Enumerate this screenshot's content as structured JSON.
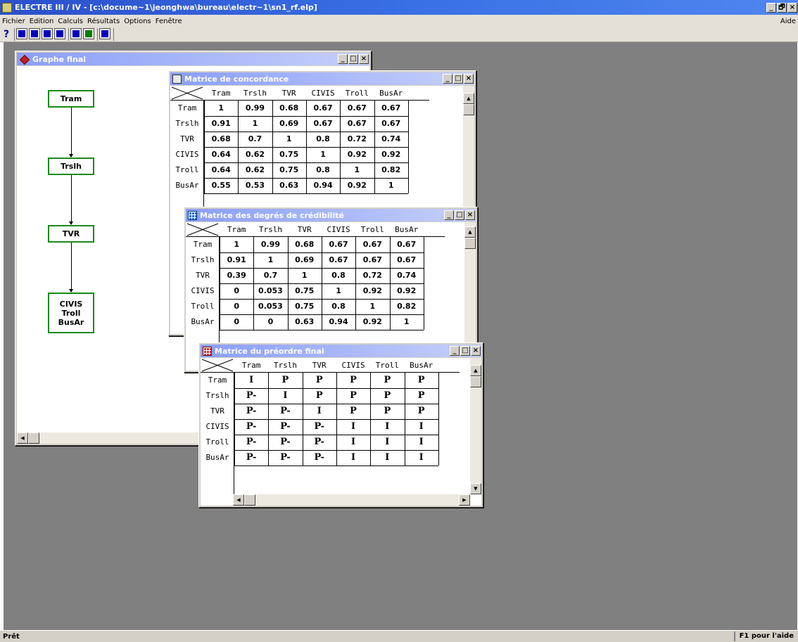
{
  "app": {
    "title": "ELECTRE  III / IV - [c:\\docume~1\\jeonghwa\\bureau\\electr~1\\sn1_rf.elp]",
    "minimize": "_",
    "restore": "🗗",
    "close": "×"
  },
  "menu": {
    "items": [
      "Fichier",
      "Edition",
      "Calculs",
      "Résultats",
      "Options",
      "Fenêtre"
    ],
    "help": "Aide"
  },
  "toolbar": {
    "help_glyph": "?",
    "buttons": [
      {
        "name": "open-file-icon",
        "color": "#0000c0"
      },
      {
        "name": "import-icon",
        "color": "#0000c0"
      },
      {
        "name": "export-icon",
        "color": "#0000c0"
      },
      {
        "name": "print-icon",
        "color": "#0000c0"
      },
      {
        "name": "calculator-icon",
        "color": "#0000c0"
      },
      {
        "name": "results-icon",
        "color": "#008000"
      },
      {
        "name": "graph-icon",
        "color": "#0000c0"
      }
    ]
  },
  "status": {
    "left": "Prêt",
    "right": "F1 pour l'aide"
  },
  "graph_window": {
    "title": "Graphe final",
    "nodes": [
      {
        "labels": [
          "Tram"
        ]
      },
      {
        "labels": [
          "Trslh"
        ]
      },
      {
        "labels": [
          "TVR"
        ]
      },
      {
        "labels": [
          "CIVIS",
          "Troll",
          "BusAr"
        ]
      }
    ]
  },
  "concordance_window": {
    "title": "Matrice de concordance",
    "columns": [
      "Tram",
      "Trslh",
      "TVR",
      "CIVIS",
      "Troll",
      "BusAr"
    ],
    "rows": [
      "Tram",
      "Trslh",
      "TVR",
      "CIVIS",
      "Troll",
      "BusAr"
    ],
    "values": [
      [
        "1",
        "0.99",
        "0.68",
        "0.67",
        "0.67",
        "0.67"
      ],
      [
        "0.91",
        "1",
        "0.69",
        "0.67",
        "0.67",
        "0.67"
      ],
      [
        "0.68",
        "0.7",
        "1",
        "0.8",
        "0.72",
        "0.74"
      ],
      [
        "0.64",
        "0.62",
        "0.75",
        "1",
        "0.92",
        "0.92"
      ],
      [
        "0.64",
        "0.62",
        "0.75",
        "0.8",
        "1",
        "0.82"
      ],
      [
        "0.55",
        "0.53",
        "0.63",
        "0.94",
        "0.92",
        "1"
      ]
    ]
  },
  "credibility_window": {
    "title": "Matrice des degrés de crédibilité",
    "columns": [
      "Tram",
      "Trslh",
      "TVR",
      "CIVIS",
      "Troll",
      "BusAr"
    ],
    "rows": [
      "Tram",
      "Trslh",
      "TVR",
      "CIVIS",
      "Troll",
      "BusAr"
    ],
    "values": [
      [
        "1",
        "0.99",
        "0.68",
        "0.67",
        "0.67",
        "0.67"
      ],
      [
        "0.91",
        "1",
        "0.69",
        "0.67",
        "0.67",
        "0.67"
      ],
      [
        "0.39",
        "0.7",
        "1",
        "0.8",
        "0.72",
        "0.74"
      ],
      [
        "0",
        "0.053",
        "0.75",
        "1",
        "0.92",
        "0.92"
      ],
      [
        "0",
        "0.053",
        "0.75",
        "0.8",
        "1",
        "0.82"
      ],
      [
        "0",
        "0",
        "0.63",
        "0.94",
        "0.92",
        "1"
      ]
    ]
  },
  "preorder_window": {
    "title": "Matrice du préordre final",
    "columns": [
      "Tram",
      "Trslh",
      "TVR",
      "CIVIS",
      "Troll",
      "BusAr"
    ],
    "rows": [
      "Tram",
      "Trslh",
      "TVR",
      "CIVIS",
      "Troll",
      "BusAr"
    ],
    "values": [
      [
        "I",
        "P",
        "P",
        "P",
        "P",
        "P"
      ],
      [
        "P-",
        "I",
        "P",
        "P",
        "P",
        "P"
      ],
      [
        "P-",
        "P-",
        "I",
        "P",
        "P",
        "P"
      ],
      [
        "P-",
        "P-",
        "P-",
        "I",
        "I",
        "I"
      ],
      [
        "P-",
        "P-",
        "P-",
        "I",
        "I",
        "I"
      ],
      [
        "P-",
        "P-",
        "P-",
        "I",
        "I",
        "I"
      ]
    ]
  }
}
